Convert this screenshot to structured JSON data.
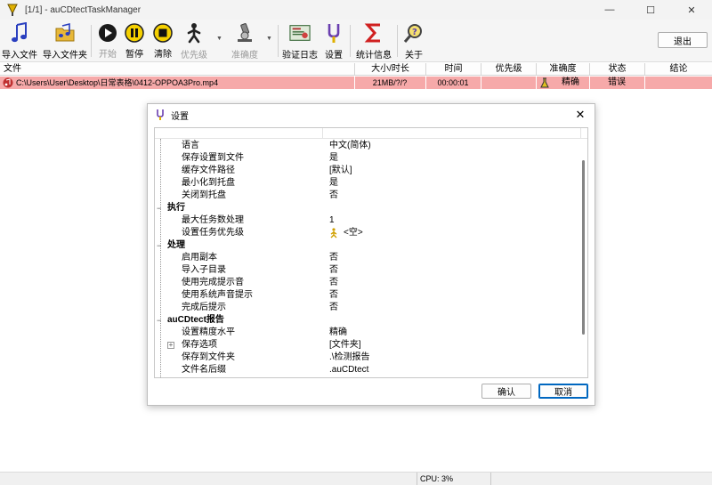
{
  "window": {
    "title": "[1/1] - auCDtectTaskManager",
    "minimize": "—",
    "maximize": "☐",
    "close": "✕"
  },
  "toolbar": {
    "import_file": "导入文件",
    "import_folder": "导入文件夹",
    "start": "开始",
    "pause": "暂停",
    "clear": "清除",
    "priority": "优先级",
    "accuracy": "准确度",
    "verify_log": "验证日志",
    "settings": "设置",
    "stats": "统计信息",
    "about": "关于",
    "exit": "退出"
  },
  "list": {
    "columns": [
      "文件",
      "大小/时长",
      "时间",
      "优先级",
      "准确度",
      "状态",
      "结论"
    ],
    "rows": [
      {
        "file": "C:\\Users\\User\\Desktop\\日常表格\\0412-OPPOA3Pro.mp4",
        "size": "21MB/?/?",
        "time": "00:00:01",
        "priority": "",
        "accuracy": "精确",
        "status": "错误",
        "result": ""
      }
    ]
  },
  "dialog": {
    "title": "设置",
    "close": "✕",
    "items": [
      {
        "key": "语言",
        "value": "中文(简体)"
      },
      {
        "key": "保存设置到文件",
        "value": "是"
      },
      {
        "key": "缓存文件路径",
        "value": "[默认]"
      },
      {
        "key": "最小化到托盘",
        "value": "是"
      },
      {
        "key": "关闭到托盘",
        "value": "否"
      },
      {
        "group": "执行"
      },
      {
        "key": "最大任务数处理",
        "value": "1"
      },
      {
        "key": "设置任务优先级",
        "value": "<空>"
      },
      {
        "group": "处理"
      },
      {
        "key": "启用副本",
        "value": "否"
      },
      {
        "key": "导入子目录",
        "value": "否"
      },
      {
        "key": "使用完成提示音",
        "value": "否"
      },
      {
        "key": "使用系统声音提示",
        "value": "否"
      },
      {
        "key": "完成后提示",
        "value": "否"
      },
      {
        "group": "auCDtect报告"
      },
      {
        "key": "设置精度水平",
        "value": "精确"
      },
      {
        "key": "保存选项",
        "value": "[文件夹]"
      },
      {
        "key": "保存到文件夹",
        "value": ".\\检测报告"
      },
      {
        "key": "文件名后缀",
        "value": ".auCDtect"
      }
    ],
    "ok": "确认",
    "cancel": "取消"
  },
  "status": {
    "cpu": "CPU: 3%"
  },
  "colors": {
    "error_row": "#f6a9a9",
    "accent": "#0067c0"
  }
}
